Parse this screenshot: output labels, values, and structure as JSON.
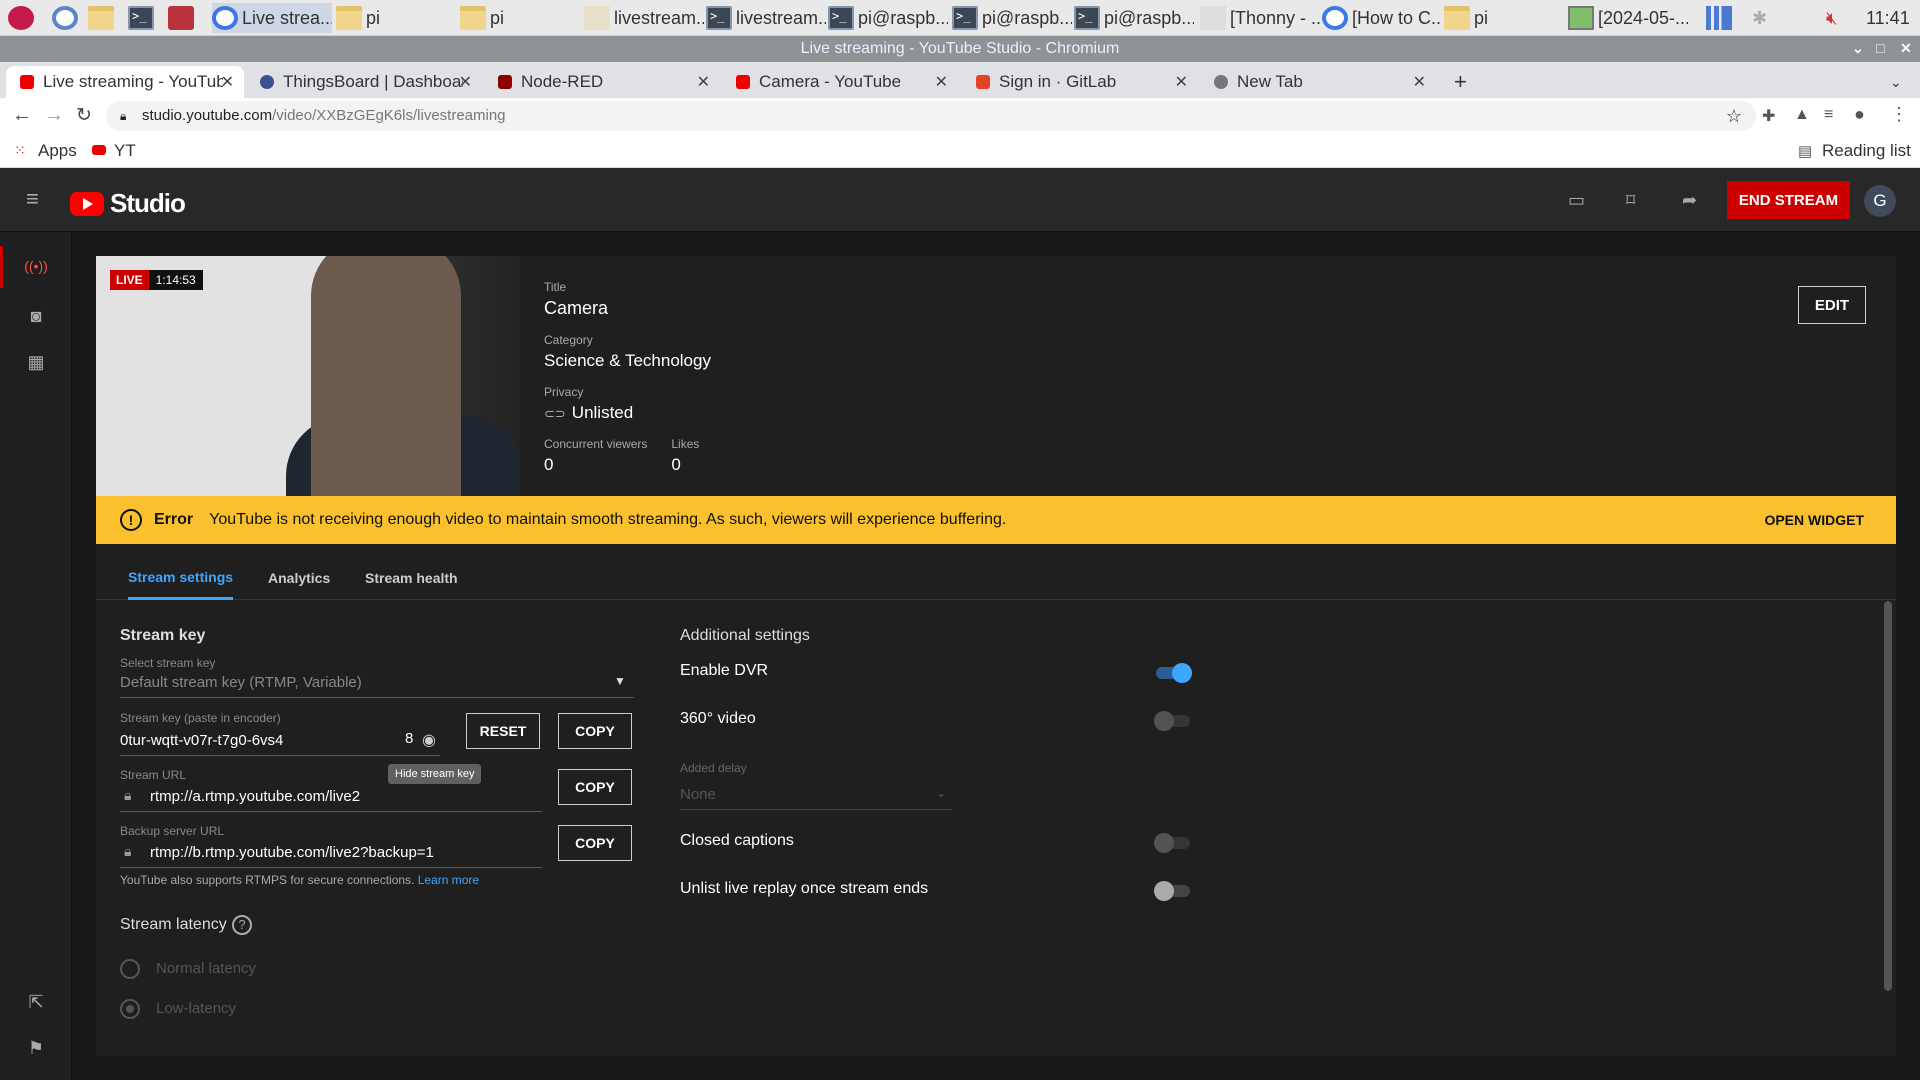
{
  "taskbar": {
    "items": [
      {
        "label": "Live strea..."
      },
      {
        "label": "pi"
      },
      {
        "label": "pi"
      },
      {
        "label": "livestream..."
      },
      {
        "label": "livestream..."
      },
      {
        "label": "pi@raspb..."
      },
      {
        "label": "pi@raspb..."
      },
      {
        "label": "pi@raspb..."
      },
      {
        "label": "[Thonny  - ..."
      },
      {
        "label": "[How to C..."
      },
      {
        "label": "pi"
      },
      {
        "label": "[2024-05-..."
      }
    ],
    "clock": "11:41"
  },
  "window": {
    "title": "Live streaming - YouTube Studio - Chromium"
  },
  "browser": {
    "tabs": [
      {
        "label": "Live streaming - YouTube Studio"
      },
      {
        "label": "ThingsBoard | Dashboards"
      },
      {
        "label": "Node-RED"
      },
      {
        "label": "Camera - YouTube"
      },
      {
        "label": "Sign in · GitLab"
      },
      {
        "label": "New Tab"
      }
    ],
    "url_host": "studio.youtube.com",
    "url_path": "/video/XXBzGEgK6ls/livestreaming",
    "bookmarks": {
      "apps": "Apps",
      "yt": "YT",
      "reading_list": "Reading list"
    }
  },
  "studio": {
    "logo": "Studio",
    "end_stream": "END STREAM",
    "avatar": "G",
    "live_badge": "LIVE",
    "live_time": "1:14:53",
    "title_label": "Title",
    "title": "Camera",
    "category_label": "Category",
    "category": "Science & Technology",
    "privacy_label": "Privacy",
    "privacy": "Unlisted",
    "viewers_label": "Concurrent viewers",
    "viewers": "0",
    "likes_label": "Likes",
    "likes": "0",
    "edit": "EDIT",
    "error_title": "Error",
    "error_text": "YouTube is not receiving enough video to maintain smooth streaming. As such, viewers will experience buffering.",
    "open_widget": "OPEN WIDGET",
    "tabs": [
      "Stream settings",
      "Analytics",
      "Stream health"
    ],
    "stream_key_title": "Stream key",
    "select_key_label": "Select stream key",
    "select_key_value": "Default stream key (RTMP, Variable)",
    "key_label": "Stream key (paste in encoder)",
    "key_value": "0tur-wqtt-v07r-t7g0-6vs4",
    "key_count": "8",
    "reset": "RESET",
    "copy": "COPY",
    "hide_tooltip": "Hide stream key",
    "url_label": "Stream URL",
    "url_value": "rtmp://a.rtmp.youtube.com/live2",
    "backup_label": "Backup server URL",
    "backup_value": "rtmp://b.rtmp.youtube.com/live2?backup=1",
    "rtmps_note": "YouTube also supports RTMPS for secure connections.",
    "learn_more": "Learn more",
    "latency_title": "Stream latency",
    "latency_options": [
      "Normal latency",
      "Low-latency"
    ],
    "additional_title": "Additional settings",
    "settings": {
      "dvr": "Enable DVR",
      "vr360": "360° video",
      "delay_label": "Added delay",
      "delay_value": "None",
      "captions": "Closed captions",
      "unlist": "Unlist live replay once stream ends"
    },
    "colors": {
      "accent": "#3ea6ff",
      "danger": "#cc0000",
      "warning": "#fbc02d"
    }
  }
}
